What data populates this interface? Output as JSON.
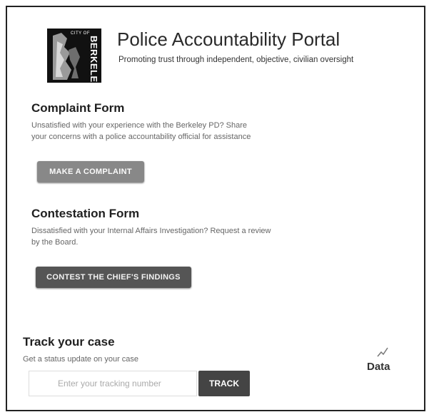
{
  "header": {
    "logo_city": "CITY OF",
    "logo_name": "BERKELEY",
    "title": "Police Accountability Portal",
    "subtitle": "Promoting trust through independent, objective, civilian oversight"
  },
  "complaint": {
    "heading": "Complaint Form",
    "description": "Unsatisfied with your experience with the Berkeley PD? Share your concerns with a police accountability official for assistance",
    "button_label": "MAKE A COMPLAINT"
  },
  "contestation": {
    "heading": "Contestation Form",
    "description": "Dissatisfied with your Internal Affairs Investigation? Request a review by the Board.",
    "button_label": "CONTEST THE CHIEF'S FINDINGS"
  },
  "track": {
    "heading": "Track your case",
    "description": "Get a status update on your case",
    "input_placeholder": "Enter your tracking number",
    "input_value": "",
    "button_label": "TRACK"
  },
  "data_link": {
    "label": "Data",
    "icon": "chart-line-icon"
  },
  "colors": {
    "primary_button": "#555555",
    "disabled_button": "#888888",
    "track_button": "#444444"
  }
}
